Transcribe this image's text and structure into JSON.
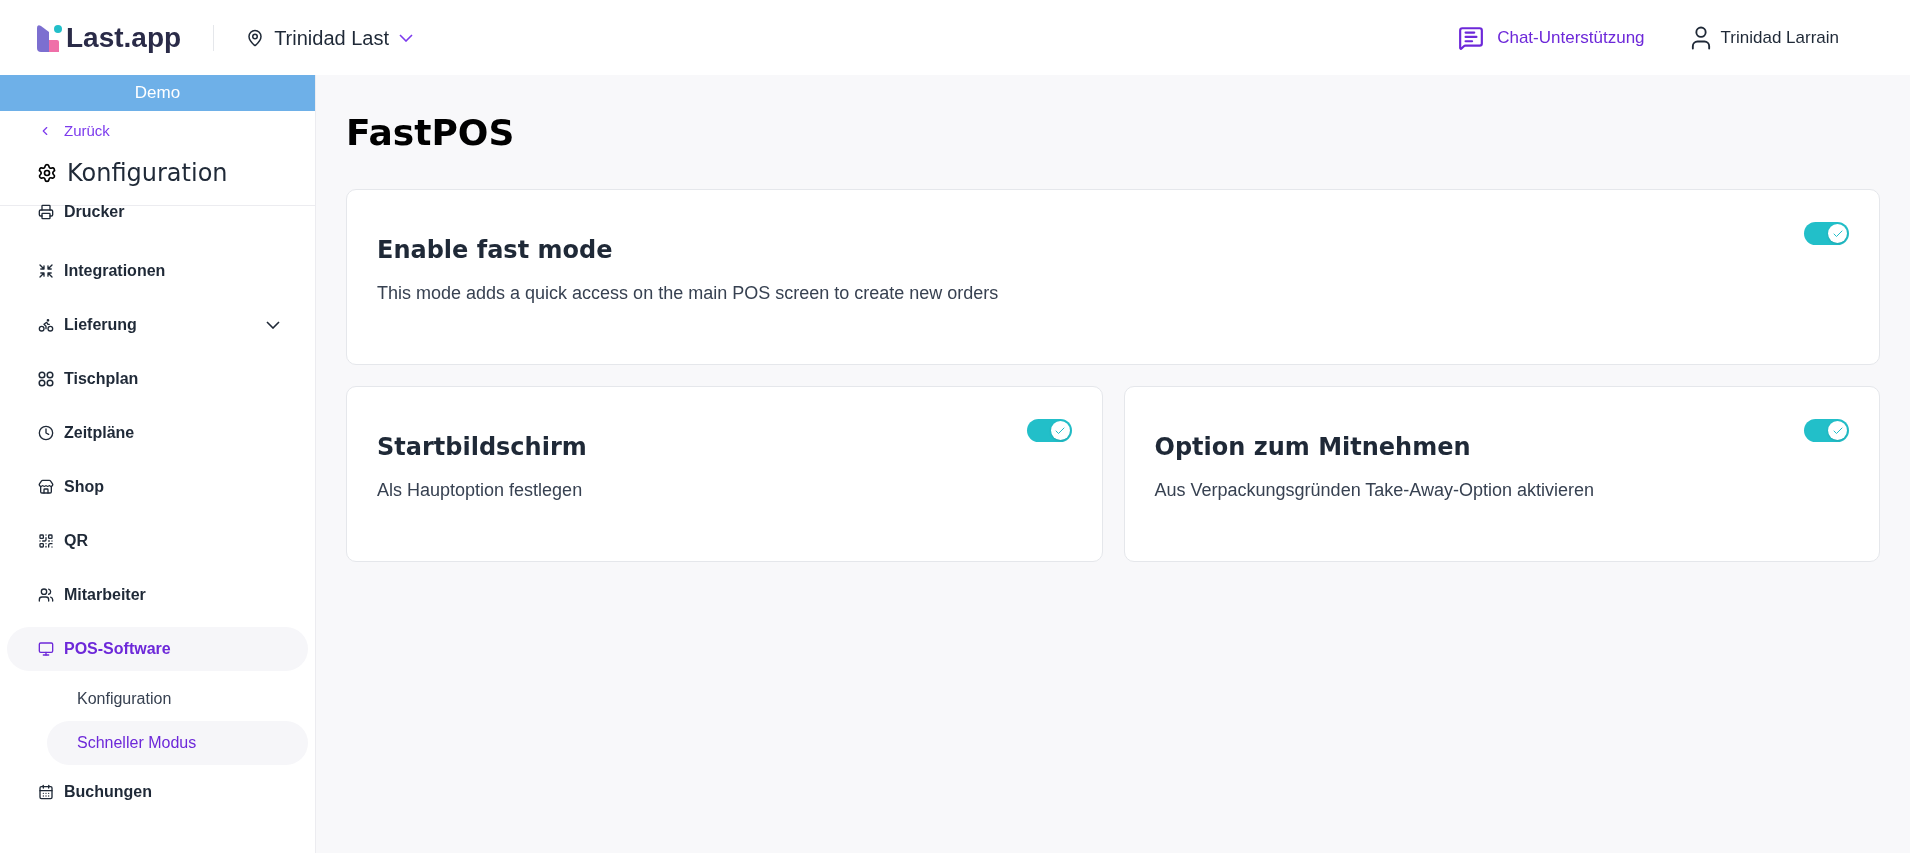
{
  "header": {
    "logo": "Last.app",
    "location": "Trinidad Last",
    "support": "Chat-Unterstützung",
    "user": "Trinidad Larrain"
  },
  "sidebar": {
    "banner": "Demo",
    "back": "Zurück",
    "title": "Konfiguration",
    "items": [
      {
        "label": "Drucker",
        "selected": false
      },
      {
        "label": "Integrationen",
        "selected": false
      },
      {
        "label": "Lieferung",
        "selected": false,
        "expanded": false
      },
      {
        "label": "Tischplan",
        "selected": false
      },
      {
        "label": "Zeitpläne",
        "selected": false
      },
      {
        "label": "Shop",
        "selected": false
      },
      {
        "label": "QR",
        "selected": false
      },
      {
        "label": "Mitarbeiter",
        "selected": false
      },
      {
        "label": "POS-Software",
        "selected": true,
        "children": [
          {
            "label": "Konfiguration",
            "selected": false
          },
          {
            "label": "Schneller Modus",
            "selected": true
          }
        ]
      },
      {
        "label": "Buchungen",
        "selected": false
      }
    ]
  },
  "page": {
    "title": "FastPOS",
    "settings": [
      {
        "title": "Enable fast mode",
        "description": "This mode adds a quick access on the main POS screen to create new orders",
        "on": true
      },
      {
        "title": "Startbildschirm",
        "description": "Als Hauptoption festlegen",
        "on": true
      },
      {
        "title": "Option zum Mitnehmen",
        "description": "Aus Verpackungsgründen Take-Away-Option aktivieren",
        "on": true
      }
    ]
  }
}
